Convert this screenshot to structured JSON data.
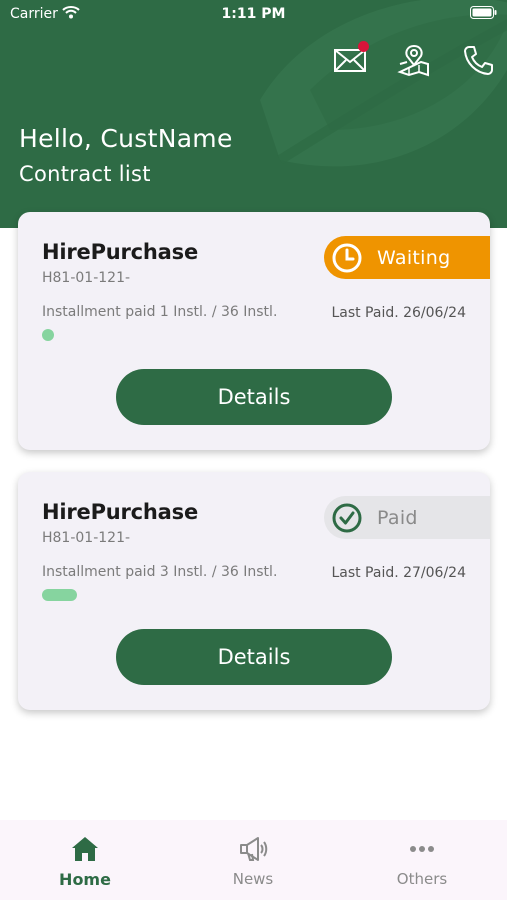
{
  "status_bar": {
    "carrier": "Carrier",
    "time": "1:11 PM"
  },
  "header": {
    "greeting": "Hello, CustName",
    "subtitle": "Contract list",
    "icons": [
      "mail-icon",
      "map-pin-icon",
      "phone-icon"
    ],
    "has_unread_mail": true
  },
  "contracts": [
    {
      "title": "HirePurchase",
      "number": "H81-01-121-",
      "installment": "Installment paid 1 Instl. / 36 Instl.",
      "last_paid": "Last Paid. 26/06/24",
      "paid_installments": 1,
      "total_installments": 36,
      "status": "Waiting",
      "status_icon": "clock-icon",
      "details_label": "Details"
    },
    {
      "title": "HirePurchase",
      "number": "H81-01-121-",
      "installment": "Installment paid 3 Instl. / 36 Instl.",
      "last_paid": "Last Paid. 27/06/24",
      "paid_installments": 3,
      "total_installments": 36,
      "status": "Paid",
      "status_icon": "check-circle-icon",
      "details_label": "Details"
    }
  ],
  "bottom_nav": {
    "items": [
      {
        "label": "Home",
        "icon": "home-icon",
        "active": true
      },
      {
        "label": "News",
        "icon": "megaphone-icon",
        "active": false
      },
      {
        "label": "Others",
        "icon": "more-dots-icon",
        "active": false
      }
    ]
  },
  "colors": {
    "primary": "#2e6b45",
    "waiting": "#ef9400",
    "progress": "#86d49f",
    "notification": "#d9143a"
  }
}
